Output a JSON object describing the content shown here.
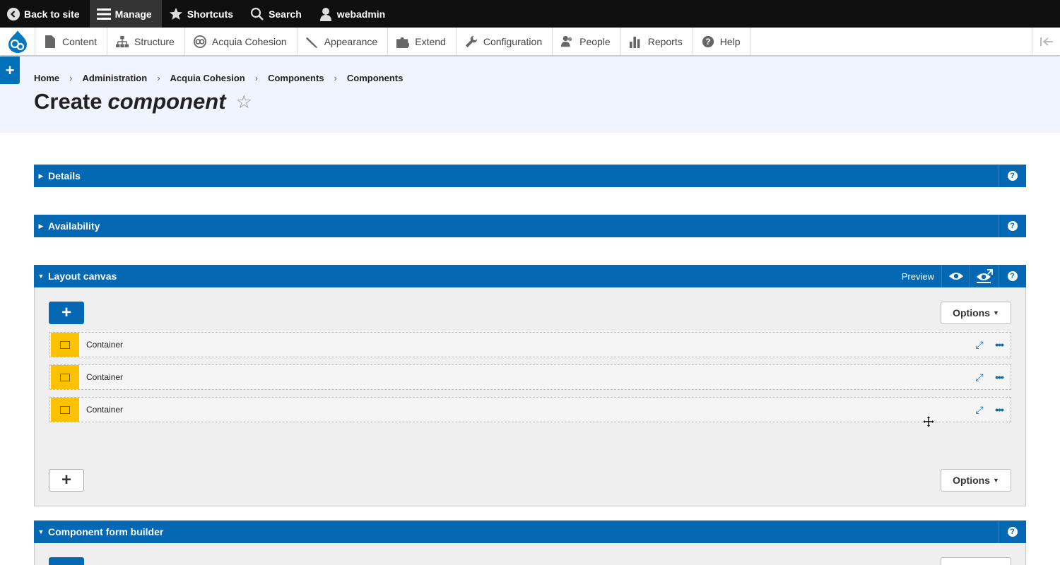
{
  "topbar": {
    "back": "Back to site",
    "manage": "Manage",
    "shortcuts": "Shortcuts",
    "search": "Search",
    "user": "webadmin"
  },
  "tray": {
    "items": [
      "Content",
      "Structure",
      "Acquia Cohesion",
      "Appearance",
      "Extend",
      "Configuration",
      "People",
      "Reports",
      "Help"
    ]
  },
  "side_plus": "+",
  "breadcrumb": [
    "Home",
    "Administration",
    "Acquia Cohesion",
    "Components",
    "Components"
  ],
  "breadcrumb_sep": "›",
  "page_title": {
    "prefix": "Create",
    "emphasis": "component",
    "star": "☆"
  },
  "panels": {
    "details": "Details",
    "availability": "Availability",
    "layout_canvas": "Layout canvas",
    "preview": "Preview",
    "form_builder": "Component form builder",
    "help": "?"
  },
  "canvas": {
    "add": "+",
    "options": "Options",
    "rows": [
      "Container",
      "Container",
      "Container"
    ]
  },
  "colors": {
    "accent": "#0568b3",
    "container": "#fcc100",
    "header_bg": "#f0f4fe"
  }
}
